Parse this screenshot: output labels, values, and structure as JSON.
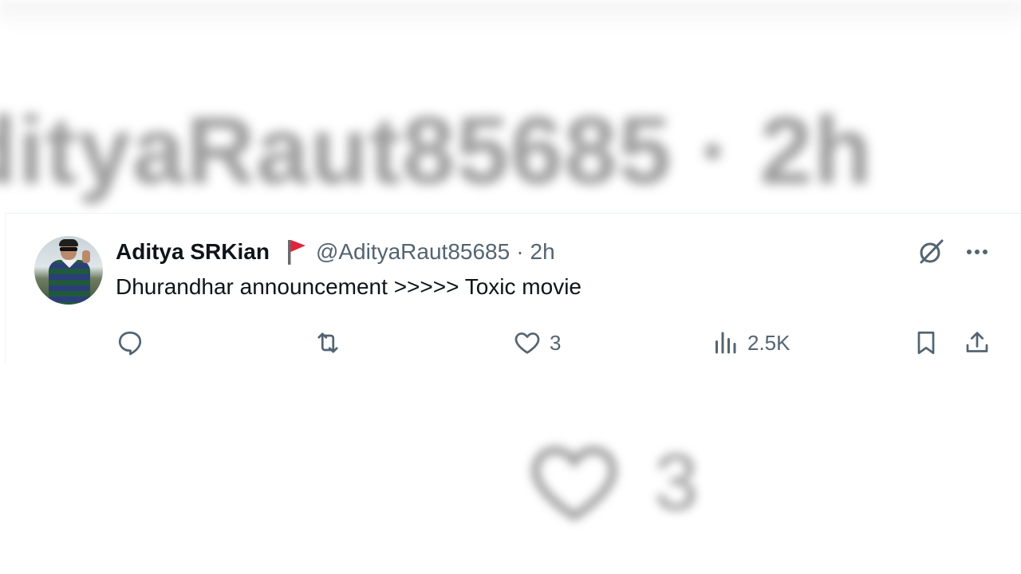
{
  "background": {
    "blurred_handle_text": "dityaRaut85685 · 2h",
    "blurred_like_count": "3"
  },
  "tweet": {
    "display_name": "Aditya SRKian",
    "handle": "@AdityaRaut85685",
    "separator": "·",
    "time": "2h",
    "text": "Dhurandhar announcement >>>>> Toxic movie",
    "likes": "3",
    "views": "2.5K"
  },
  "icons": {
    "badge": "red-flag-icon",
    "grok": "grok-icon",
    "more": "more-icon",
    "reply": "reply-icon",
    "repost": "repost-icon",
    "like": "heart-icon",
    "views": "views-icon",
    "bookmark": "bookmark-icon",
    "share": "share-icon"
  },
  "colors": {
    "text_primary": "#0f1419",
    "text_secondary": "#536471",
    "flag_red": "#e0243b"
  }
}
